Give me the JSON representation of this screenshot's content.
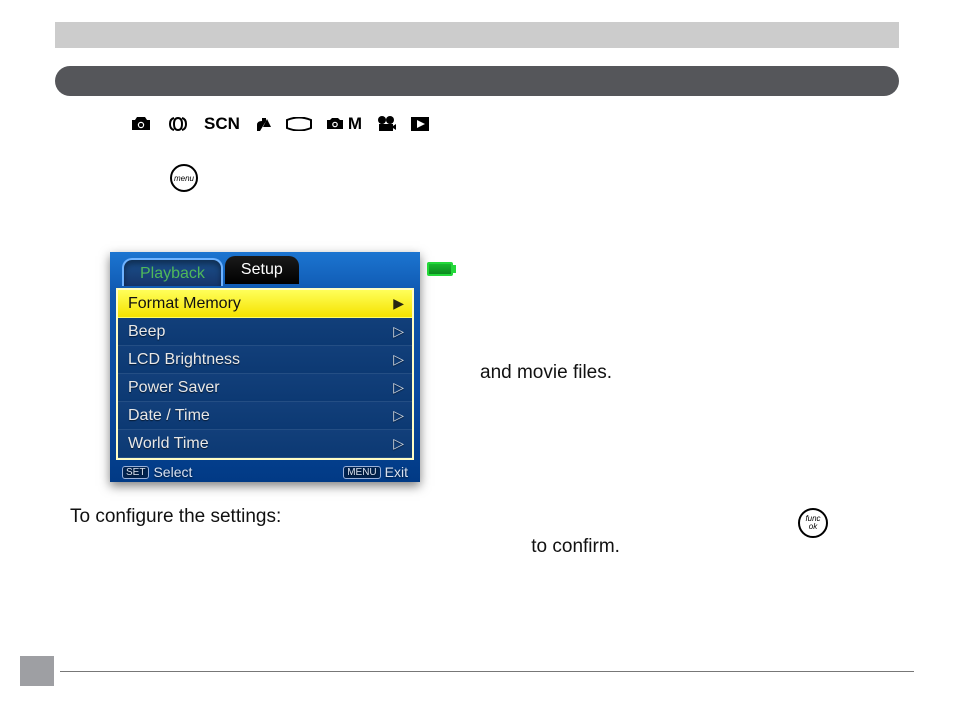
{
  "modes": {
    "scn_label": "SCN",
    "m_label": "M"
  },
  "menu_button_label": "menu",
  "func_button_top": "func",
  "func_button_bottom": "ok",
  "lcd": {
    "tabs": {
      "inactive": "Playback",
      "active": "Setup"
    },
    "items": [
      {
        "label": "Format Memory",
        "selected": true
      },
      {
        "label": "Beep",
        "selected": false
      },
      {
        "label": "LCD Brightness",
        "selected": false
      },
      {
        "label": "Power Saver",
        "selected": false
      },
      {
        "label": "Date / Time",
        "selected": false
      },
      {
        "label": "World Time",
        "selected": false
      }
    ],
    "footer": {
      "select_key": "SET",
      "select_label": "Select",
      "exit_key": "MENU",
      "exit_label": "Exit"
    }
  },
  "body_text": {
    "right1": "and movie files.",
    "config": "To configure the settings:",
    "confirm": "to confirm."
  }
}
